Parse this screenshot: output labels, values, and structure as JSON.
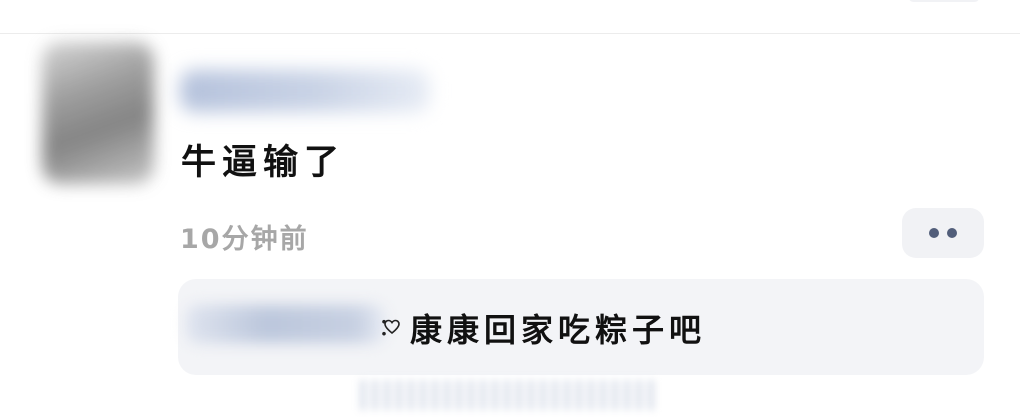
{
  "comment": {
    "text": "牛逼输了",
    "time": "10分钟前"
  },
  "reply": {
    "separator": "：",
    "text": "康康回家吃粽子吧"
  },
  "icons": {
    "more": "more-dots-icon",
    "reply_emoji": "heart-icon"
  },
  "colors": {
    "text_primary": "#111111",
    "text_secondary": "#a7a7a7",
    "reply_bg": "#f3f4f7",
    "dots": "#525e7a"
  }
}
